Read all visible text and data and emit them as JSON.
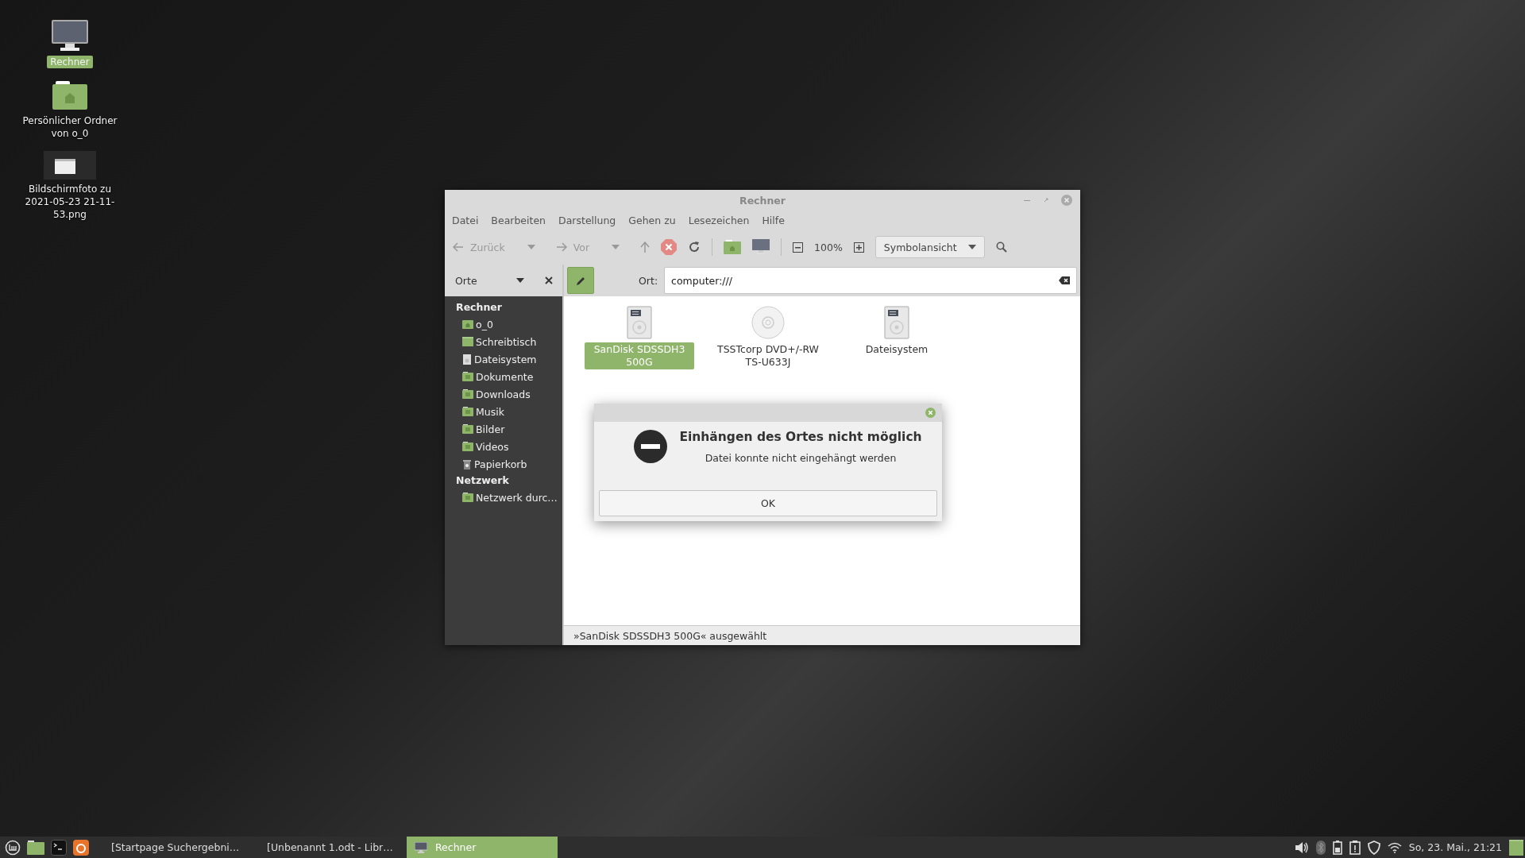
{
  "desktop_icons": [
    {
      "label": "Rechner",
      "kind": "computer",
      "selected": true
    },
    {
      "label": "Persönlicher Ordner von o_0",
      "kind": "home",
      "selected": false
    },
    {
      "label": "Bildschirmfoto zu 2021-05-23 21-11-53.png",
      "kind": "image",
      "selected": false
    }
  ],
  "window": {
    "title": "Rechner"
  },
  "menu": [
    "Datei",
    "Bearbeiten",
    "Darstellung",
    "Gehen zu",
    "Lesezeichen",
    "Hilfe"
  ],
  "toolbar": {
    "back": "Zurück",
    "forward": "Vor",
    "zoom": "100%",
    "view": "Symbolansicht"
  },
  "sidebar": {
    "selector": "Orte",
    "sections": [
      {
        "title": "Rechner",
        "items": [
          {
            "label": "o_0",
            "kind": "home"
          },
          {
            "label": "Schreibtisch",
            "kind": "desktop"
          },
          {
            "label": "Dateisystem",
            "kind": "drive"
          },
          {
            "label": "Dokumente",
            "kind": "folder"
          },
          {
            "label": "Downloads",
            "kind": "folder"
          },
          {
            "label": "Musik",
            "kind": "folder"
          },
          {
            "label": "Bilder",
            "kind": "folder"
          },
          {
            "label": "Videos",
            "kind": "folder"
          },
          {
            "label": "Papierkorb",
            "kind": "trash"
          }
        ]
      },
      {
        "title": "Netzwerk",
        "items": [
          {
            "label": "Netzwerk durc…",
            "kind": "folder"
          }
        ]
      }
    ]
  },
  "location": {
    "label": "Ort:",
    "value": "computer:///"
  },
  "items": [
    {
      "label": "SanDisk SDSSDH3 500G",
      "kind": "disk",
      "selected": true
    },
    {
      "label": "TSSTcorp DVD+/-RW TS-U633J",
      "kind": "optical",
      "selected": false
    },
    {
      "label": "Dateisystem",
      "kind": "disk",
      "selected": false
    }
  ],
  "status_bar": "»SanDisk SDSSDH3 500G« ausgewählt",
  "dialog": {
    "title": "Einhängen des Ortes nicht möglich",
    "message": "Datei konnte nicht eingehängt werden",
    "button": "OK"
  },
  "taskbar": {
    "windows": [
      {
        "label": "[Startpage Suchergebni…",
        "kind": "browser",
        "selected": false
      },
      {
        "label": "[Unbenannt 1.odt - Libr…",
        "kind": "document",
        "selected": false
      },
      {
        "label": "Rechner",
        "kind": "computer",
        "selected": true
      }
    ],
    "clock": "So, 23. Mai., 21:21"
  }
}
